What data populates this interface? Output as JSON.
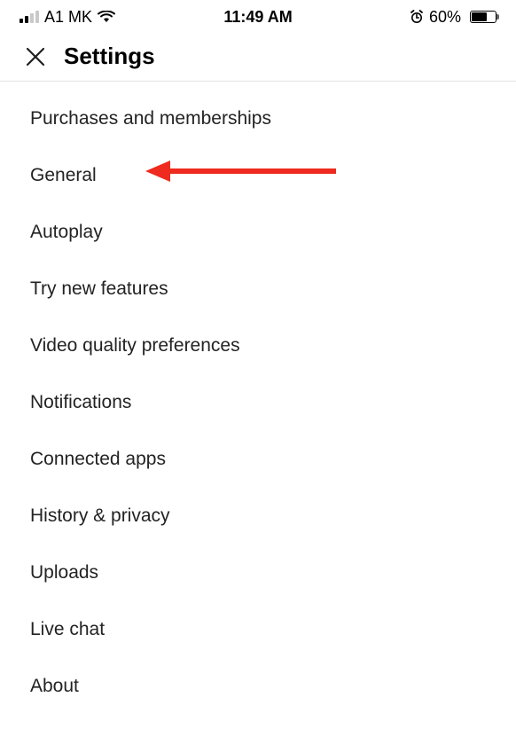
{
  "status_bar": {
    "carrier": "A1 MK",
    "time": "11:49 AM",
    "battery_percent": "60%"
  },
  "header": {
    "title": "Settings"
  },
  "settings_items": {
    "0": "Purchases and memberships",
    "1": "General",
    "2": "Autoplay",
    "3": "Try new features",
    "4": "Video quality preferences",
    "5": "Notifications",
    "6": "Connected apps",
    "7": "History & privacy",
    "8": "Uploads",
    "9": "Live chat",
    "10": "About"
  },
  "annotation": {
    "arrow_color": "#ef2a1f",
    "points_to": "General"
  }
}
